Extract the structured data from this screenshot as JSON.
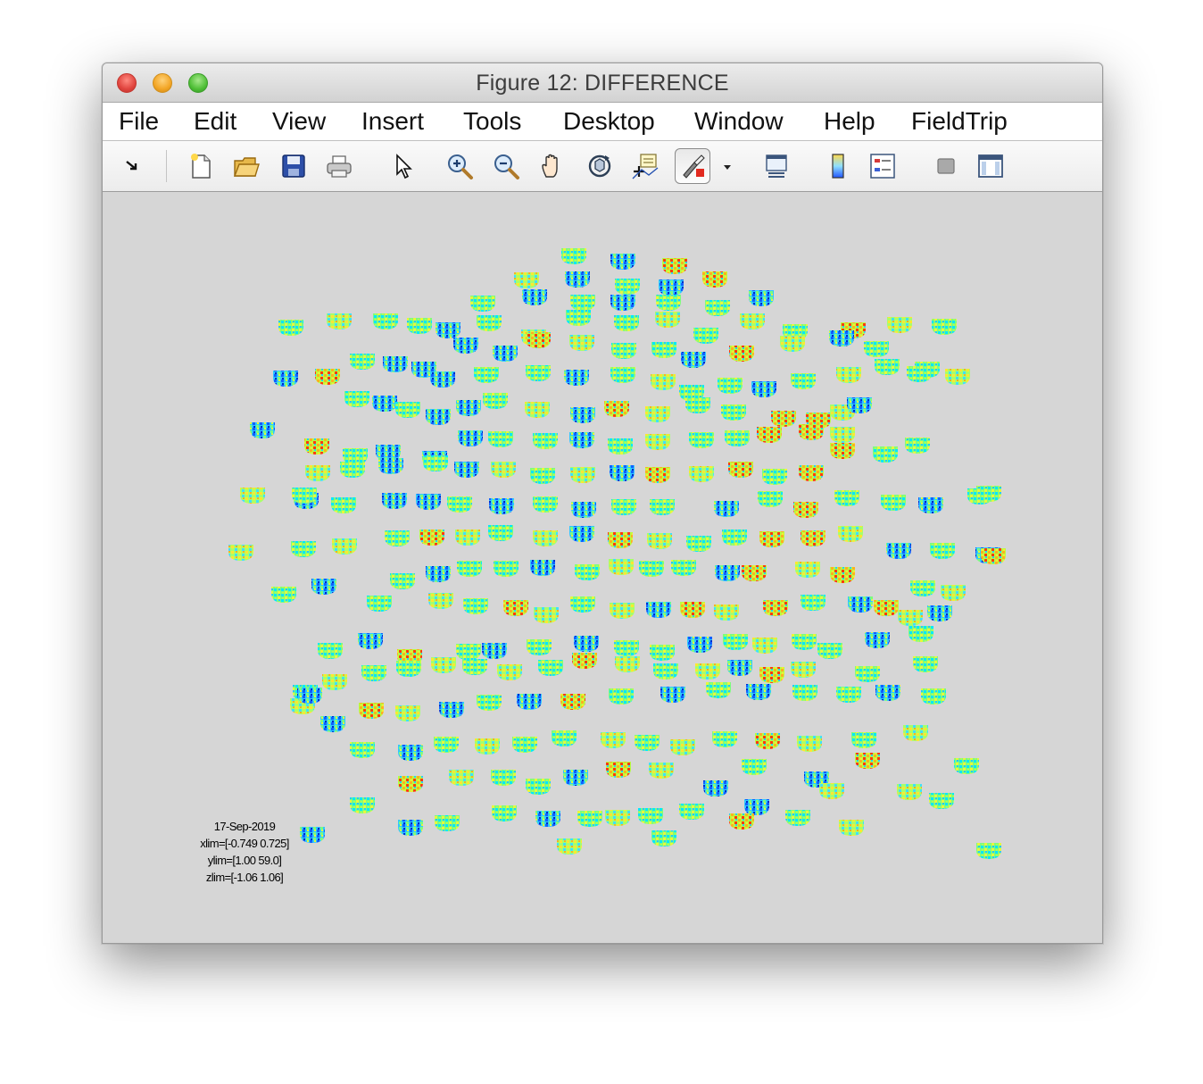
{
  "window": {
    "title": "Figure 12: DIFFERENCE"
  },
  "menu": [
    "File",
    "Edit",
    "View",
    "Insert",
    "Tools",
    "Desktop",
    "Window",
    "Help",
    "FieldTrip"
  ],
  "toolbar": [
    "dock-arrow-icon",
    "new-figure-icon",
    "open-file-icon",
    "save-icon",
    "print-icon",
    "edit-plot-arrow-icon",
    "zoom-in-icon",
    "zoom-out-icon",
    "pan-hand-icon",
    "rotate-3d-icon",
    "data-cursor-icon",
    "brush-icon",
    "brush-dropdown-icon",
    "link-plot-icon",
    "colorbar-icon",
    "legend-icon",
    "hide-plot-tools-icon",
    "show-plot-tools-icon"
  ],
  "caption": {
    "date": "17-Sep-2019",
    "xlim": "xlim=[-0.749 0.725]",
    "ylim": "ylim=[1.00 59.0]",
    "zlim": "zlim=[-1.06 1.06]"
  },
  "colors": {
    "background": "#d6d6d6",
    "colormap": "jet"
  }
}
